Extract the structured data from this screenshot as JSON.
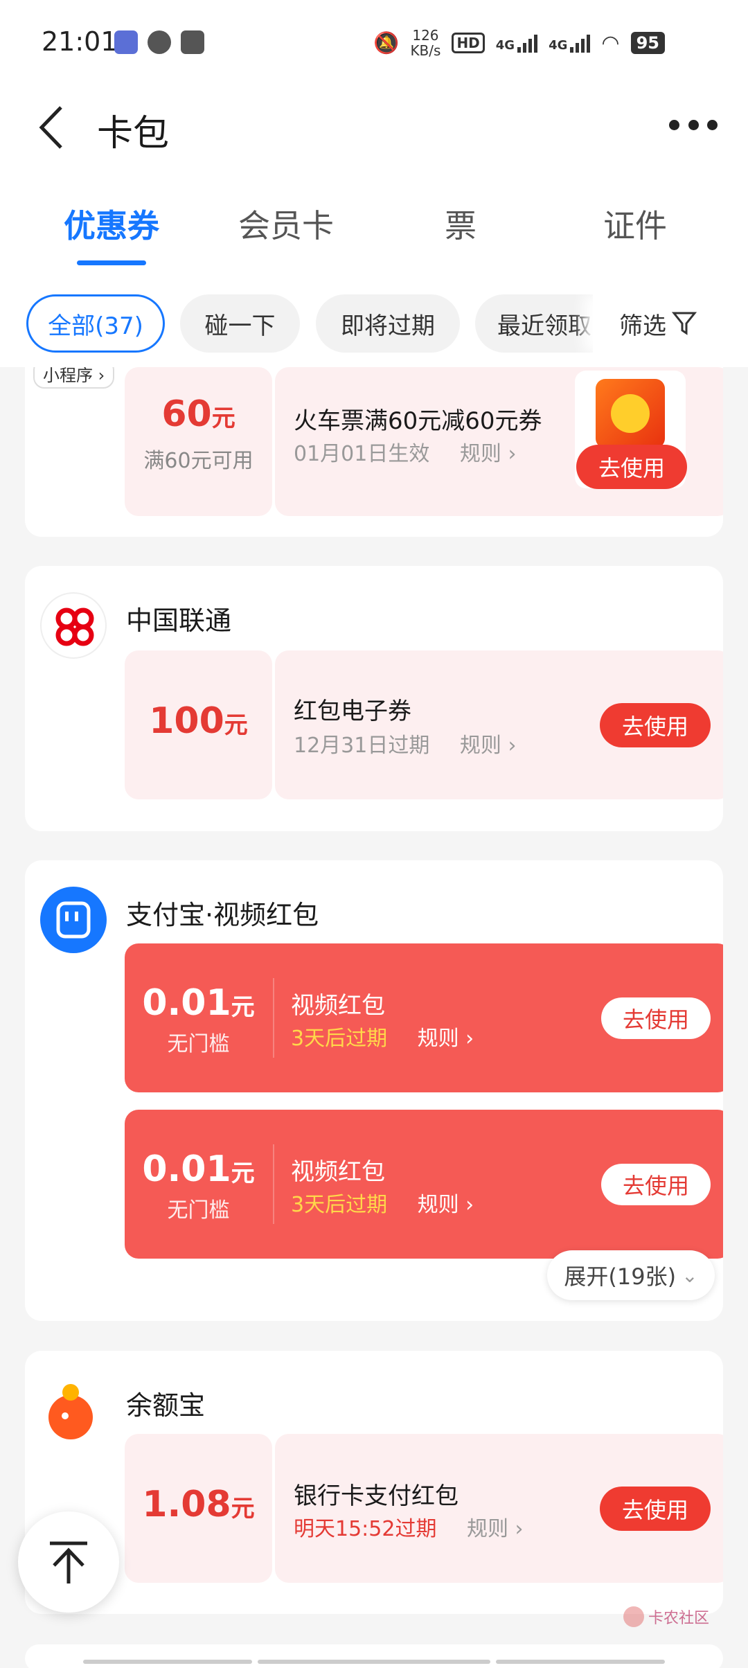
{
  "status": {
    "time": "21:01",
    "net_speed_value": "126",
    "net_speed_unit": "KB/s",
    "hd": "HD",
    "signal1": "4G",
    "signal2": "4G",
    "battery": "95"
  },
  "nav": {
    "title": "卡包"
  },
  "tabs": [
    {
      "label": "优惠券",
      "active": true
    },
    {
      "label": "会员卡"
    },
    {
      "label": "票"
    },
    {
      "label": "证件"
    }
  ],
  "chips": {
    "all": "全部(37)",
    "tap": "碰一下",
    "expiring": "即将过期",
    "recent": "最近领取",
    "filter": "筛选"
  },
  "card1": {
    "mini_tag": "小程序",
    "amount": "60",
    "unit": "元",
    "condition": "满60元可用",
    "title": "火车票满60元减60元券",
    "date": "01月01日生效",
    "rule": "规则",
    "use": "去使用"
  },
  "card2": {
    "merchant": "中国联通",
    "amount": "100",
    "unit": "元",
    "title": "红包电子券",
    "date": "12月31日过期",
    "rule": "规则",
    "use": "去使用"
  },
  "card3": {
    "merchant": "支付宝·视频红包",
    "coupons": [
      {
        "amount": "0.01",
        "unit": "元",
        "condition": "无门槛",
        "title": "视频红包",
        "expire": "3天后过期",
        "rule": "规则",
        "use": "去使用"
      },
      {
        "amount": "0.01",
        "unit": "元",
        "condition": "无门槛",
        "title": "视频红包",
        "expire": "3天后过期",
        "rule": "规则",
        "use": "去使用"
      }
    ],
    "expand": "展开(19张)"
  },
  "card4": {
    "merchant": "余额宝",
    "amount": "1.08",
    "unit": "元",
    "title": "银行卡支付红包",
    "expire": "明天15:52过期",
    "rule": "规则",
    "use": "去使用"
  },
  "watermark": "卡农社区",
  "colors": {
    "accent": "#1677ff",
    "coupon_red": "#f55a55",
    "button_red": "#ef3b31",
    "coupon_pink": "#fdeff0"
  }
}
